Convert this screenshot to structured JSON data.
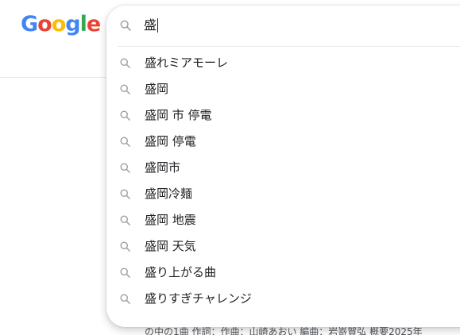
{
  "logo": {
    "letters": [
      "G",
      "o",
      "o",
      "g",
      "l",
      "e"
    ],
    "colors": [
      "#4285f4",
      "#ea4335",
      "#fbbc05",
      "#4285f4",
      "#34a853",
      "#ea4335"
    ]
  },
  "search": {
    "query": "盛",
    "icon": "search-icon"
  },
  "suggestions": [
    {
      "label": "盛れミアモーレ",
      "icon": "search-icon"
    },
    {
      "label": "盛岡",
      "icon": "search-icon"
    },
    {
      "label": "盛岡 市 停電",
      "icon": "search-icon"
    },
    {
      "label": "盛岡 停電",
      "icon": "search-icon"
    },
    {
      "label": "盛岡市",
      "icon": "search-icon"
    },
    {
      "label": "盛岡冷麺",
      "icon": "search-icon"
    },
    {
      "label": "盛岡 地震",
      "icon": "search-icon"
    },
    {
      "label": "盛岡 天気",
      "icon": "search-icon"
    },
    {
      "label": "盛り上がる曲",
      "icon": "search-icon"
    },
    {
      "label": "盛りすぎチャレンジ",
      "icon": "search-icon"
    }
  ],
  "background_snippet": "の中の1曲 作詞：作曲：山崎あおい 編曲：岩嵜賀弘 概要2025年"
}
